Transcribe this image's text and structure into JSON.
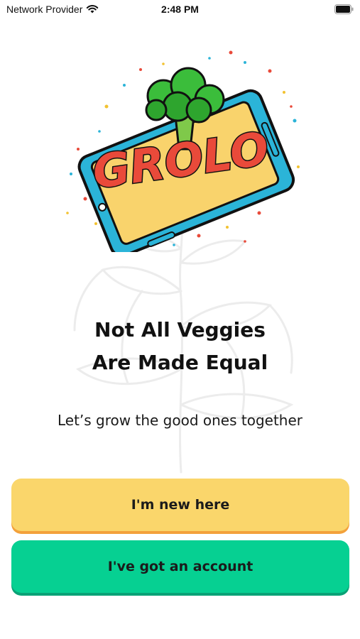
{
  "status_bar": {
    "carrier": "Network Provider",
    "time": "2:48 PM",
    "wifi_icon": "wifi-icon",
    "battery_icon": "battery-icon"
  },
  "logo": {
    "wordmark": "GROLO",
    "colors": {
      "phone": "#2bb4d8",
      "screen": "#f9d36c",
      "letters": "#e94a3a",
      "broccoli": "#3bbd3b"
    }
  },
  "headline": {
    "line1": "Not All Veggies",
    "line2": "Are Made Equal"
  },
  "tagline": "Let’s grow the good ones together",
  "buttons": {
    "new_user": {
      "label": "I'm new here",
      "color": "#fad66b"
    },
    "existing_user": {
      "label": "I've got an account",
      "color": "#06d092"
    }
  }
}
